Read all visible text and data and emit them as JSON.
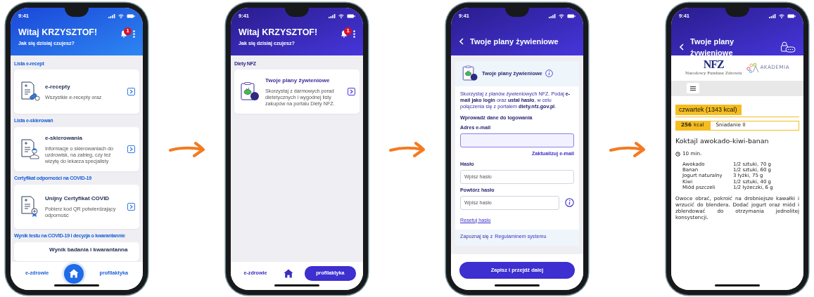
{
  "phones": [
    {
      "kind": "dashboard",
      "status_time": "9:41",
      "greeting": "Witaj KRZYSZTOF!",
      "subtitle": "Jak się dzisiaj czujesz?",
      "notification_count": "1",
      "sections": [
        {
          "heading": "Lista e-recept",
          "card": {
            "kind": "prescription",
            "title": "e-recepty",
            "text": "Wszystkie e-recepty oraz"
          }
        },
        {
          "heading": "Lista e-skierowań",
          "card": {
            "kind": "referral",
            "title": "e-skierowania",
            "text": "Informacje o skierowaniach do uzdrowisk, na zabieg, czy też wizytę do lekarza specjalisty"
          }
        },
        {
          "heading": "Certyfikat odporności na COVID-19",
          "card": {
            "kind": "certificate",
            "title": "Unijny Certyfikat COVID",
            "text": "Pobierz kod QR potwierdzający odporność"
          }
        },
        {
          "heading": "Wynik testu na COVID-19 i decyzja o kwarantannie",
          "card": {
            "title": "Wynik badania i kwarantanna"
          }
        }
      ],
      "nav": [
        {
          "kind": "text",
          "label": "e-zdrowie",
          "selected": false
        },
        {
          "kind": "home",
          "selected": true
        },
        {
          "kind": "text",
          "label": "profilaktyka",
          "selected": false
        }
      ]
    },
    {
      "kind": "dashboard",
      "status_time": "9:41",
      "greeting": "Witaj KRZYSZTOF!",
      "subtitle": "Jak się dzisiaj czujesz?",
      "notification_count": "1",
      "sections": [
        {
          "heading": "Diety NFZ",
          "card": {
            "kind": "diet",
            "title": "Twoje plany żywieniowe",
            "text": "Skorzystaj z darmowych porad dietetycznych i wygodnej listy zakupów na portalu Diety NFZ."
          }
        }
      ],
      "nav": [
        {
          "kind": "text",
          "label": "e-zdrowie",
          "selected": false
        },
        {
          "kind": "home",
          "selected": false
        },
        {
          "kind": "text",
          "label": "profilaktyka",
          "selected": true
        }
      ]
    },
    {
      "kind": "login",
      "status_time": "9:41",
      "title": "Twoje plany żywieniowe",
      "card_title": "Twoje plany żywieniowe",
      "intro": "Skorzystaj z planów żywieniowych NFZ. Podaj **e-mail jako login** oraz **ustal hasło**, w celu połączenia się z portalem **diety.nfz.gov.pl**.",
      "section_label": "Wprowadź dane do logowania",
      "fields": [
        {
          "label": "Adres e-mail",
          "focused": true,
          "info": false,
          "link": "Zaktualizuj e-mail"
        },
        {
          "label": "Hasło",
          "placeholder": "Wpisz hasło",
          "focused": false,
          "info": false
        },
        {
          "label": "Powtórz hasło",
          "placeholder": "Wpisz hasło",
          "focused": false,
          "info": true
        }
      ],
      "reset_link": "Resetuj hasło",
      "terms_text": "Zapoznaj się z",
      "terms_link": "Regulaminem systemu",
      "submit": "Zapisz i przejdź dalej"
    },
    {
      "kind": "recipe",
      "status_time": "9:41",
      "title": "Twoje plany żywieniowe",
      "logo_name": "NFZ",
      "logo_caption": "Narodowy Fundusz Zdrowia",
      "partner_logo": "AKADEMIA",
      "day_tab": "czwartek (1343 kcal)",
      "meal": {
        "kcal_value": "256",
        "kcal_unit": "kcal",
        "name": "Śniadanie II"
      },
      "recipe_title": "Koktajl awokado-kiwi-banan",
      "time": "10 min.",
      "ingredients": [
        {
          "name": "Awokado",
          "amount": "1/2 sztuki, 70 g"
        },
        {
          "name": "Banan",
          "amount": "1/2 sztuki, 60 g"
        },
        {
          "name": "Jogurt naturalny",
          "amount": "3 łyżki, 75 g"
        },
        {
          "name": "Kiwi",
          "amount": "1/2 sztuki, 40 g"
        },
        {
          "name": "Miód pszczeli",
          "amount": "1/2 łyżeczki, 6 g"
        }
      ],
      "instructions": "Owoce obrać, pokroić na drobniejsze kawałki i wrzucić do blendera. Dodać jogurt oraz miód i zblendować do otrzymania jednolitej konsystencji."
    }
  ]
}
